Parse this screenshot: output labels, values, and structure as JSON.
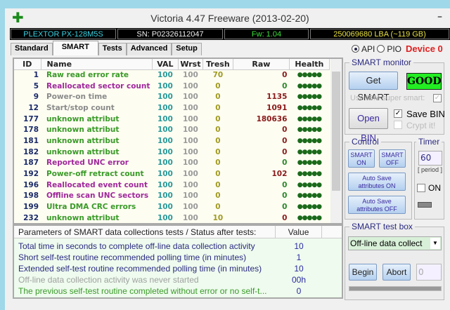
{
  "window": {
    "title": "Victoria 4.47  Freeware (2013-02-20)",
    "minimize": "–"
  },
  "info": {
    "model": "PLEXTOR PX-128M5S",
    "serial": "SN: P02326112047",
    "firmware": "Fw: 1.04",
    "capacity": "250069680 LBA (~119 GB)"
  },
  "tabs": [
    "Standard",
    "SMART",
    "Tests",
    "Advanced",
    "Setup"
  ],
  "active_tab": "SMART",
  "mode": {
    "api": "API",
    "pio": "PIO",
    "selected": "API",
    "device": "Device 0"
  },
  "table": {
    "headers": [
      "ID",
      "Name",
      "VAL",
      "Wrst",
      "Tresh",
      "Raw",
      "Health"
    ],
    "rows": [
      {
        "id": "1",
        "name": "Raw read error rate",
        "val": "100",
        "wrst": "100",
        "tresh": "70",
        "raw": "0",
        "health": "●●●●●",
        "name_color": "#3a9a28",
        "raw_color": "#8a1a1a"
      },
      {
        "id": "5",
        "name": "Reallocated sector count",
        "val": "100",
        "wrst": "100",
        "tresh": "0",
        "raw": "0",
        "health": "●●●●●",
        "name_color": "#a0289c",
        "raw_color": "#2a8a2a"
      },
      {
        "id": "9",
        "name": "Power-on time",
        "val": "100",
        "wrst": "100",
        "tresh": "0",
        "raw": "1135",
        "health": "●●●●●",
        "name_color": "#8a8a8a",
        "raw_color": "#8a1a1a"
      },
      {
        "id": "12",
        "name": "Start/stop count",
        "val": "100",
        "wrst": "100",
        "tresh": "0",
        "raw": "1091",
        "health": "●●●●●",
        "name_color": "#8a8a8a",
        "raw_color": "#8a1a1a"
      },
      {
        "id": "177",
        "name": "unknown attribut",
        "val": "100",
        "wrst": "100",
        "tresh": "0",
        "raw": "180636",
        "health": "●●●●●",
        "name_color": "#3a9a28",
        "raw_color": "#8a1a1a"
      },
      {
        "id": "178",
        "name": "unknown attribut",
        "val": "100",
        "wrst": "100",
        "tresh": "0",
        "raw": "0",
        "health": "●●●●●",
        "name_color": "#3a9a28",
        "raw_color": "#8a1a1a"
      },
      {
        "id": "181",
        "name": "unknown attribut",
        "val": "100",
        "wrst": "100",
        "tresh": "0",
        "raw": "0",
        "health": "●●●●●",
        "name_color": "#3a9a28",
        "raw_color": "#8a1a1a"
      },
      {
        "id": "182",
        "name": "unknown attribut",
        "val": "100",
        "wrst": "100",
        "tresh": "0",
        "raw": "0",
        "health": "●●●●●",
        "name_color": "#3a9a28",
        "raw_color": "#8a1a1a"
      },
      {
        "id": "187",
        "name": "Reported UNC error",
        "val": "100",
        "wrst": "100",
        "tresh": "0",
        "raw": "0",
        "health": "●●●●●",
        "name_color": "#a0289c",
        "raw_color": "#2a8a2a"
      },
      {
        "id": "192",
        "name": "Power-off retract count",
        "val": "100",
        "wrst": "100",
        "tresh": "0",
        "raw": "102",
        "health": "●●●●●",
        "name_color": "#3a9a28",
        "raw_color": "#8a1a1a"
      },
      {
        "id": "196",
        "name": "Reallocated event count",
        "val": "100",
        "wrst": "100",
        "tresh": "0",
        "raw": "0",
        "health": "●●●●●",
        "name_color": "#a0289c",
        "raw_color": "#2a8a2a"
      },
      {
        "id": "198",
        "name": "Offline scan UNC sectors",
        "val": "100",
        "wrst": "100",
        "tresh": "0",
        "raw": "0",
        "health": "●●●●●",
        "name_color": "#a0289c",
        "raw_color": "#2a8a2a"
      },
      {
        "id": "199",
        "name": "Ultra DMA CRC errors",
        "val": "100",
        "wrst": "100",
        "tresh": "0",
        "raw": "0",
        "health": "●●●●●",
        "name_color": "#3a9a28",
        "raw_color": "#2a8a2a"
      },
      {
        "id": "232",
        "name": "unknown attribut",
        "val": "100",
        "wrst": "100",
        "tresh": "10",
        "raw": "0",
        "health": "●●●●●",
        "name_color": "#3a9a28",
        "raw_color": "#8a1a1a"
      }
    ]
  },
  "params": {
    "header": "Parameters of SMART data collections tests / Status after tests:",
    "value_header": "Value",
    "rows": [
      {
        "label": "Total time in seconds to complete off-line data collection activity",
        "value": "10",
        "color": "#2a2a80"
      },
      {
        "label": "Short self-test routine recommended polling time (in minutes)",
        "value": "1",
        "color": "#2a2a80"
      },
      {
        "label": "Extended self-test routine recommended polling time (in minutes)",
        "value": "10",
        "color": "#2a2a80"
      },
      {
        "label": "Off-line data collection activity was never started",
        "value": "00h",
        "color": "#a0a0a0"
      },
      {
        "label": "The previous self-test routine completed without error or no self-t...",
        "value": "0",
        "color": "#3a9a28"
      }
    ]
  },
  "smart_monitor": {
    "title": "SMART monitor",
    "get_smart": "Get SMART",
    "status": "GOOD",
    "status_color": "#22ee22",
    "ibm": "Use IBM super smart:",
    "open_bin": "Open BIN",
    "save_bin": "Save BIN",
    "crypt": "Crypt it!"
  },
  "control": {
    "title": "Control",
    "smart_on": "SMART ON",
    "smart_off": "SMART OFF",
    "auto_on": "Auto Save attributes ON",
    "auto_off": "Auto Save attributes OFF"
  },
  "timer": {
    "title": "Timer",
    "value": "60",
    "period": "[ period ]",
    "on": "ON"
  },
  "test_box": {
    "title": "SMART test box",
    "selected": "Off-line data collect",
    "begin": "Begin",
    "abort": "Abort",
    "counter": "0"
  }
}
